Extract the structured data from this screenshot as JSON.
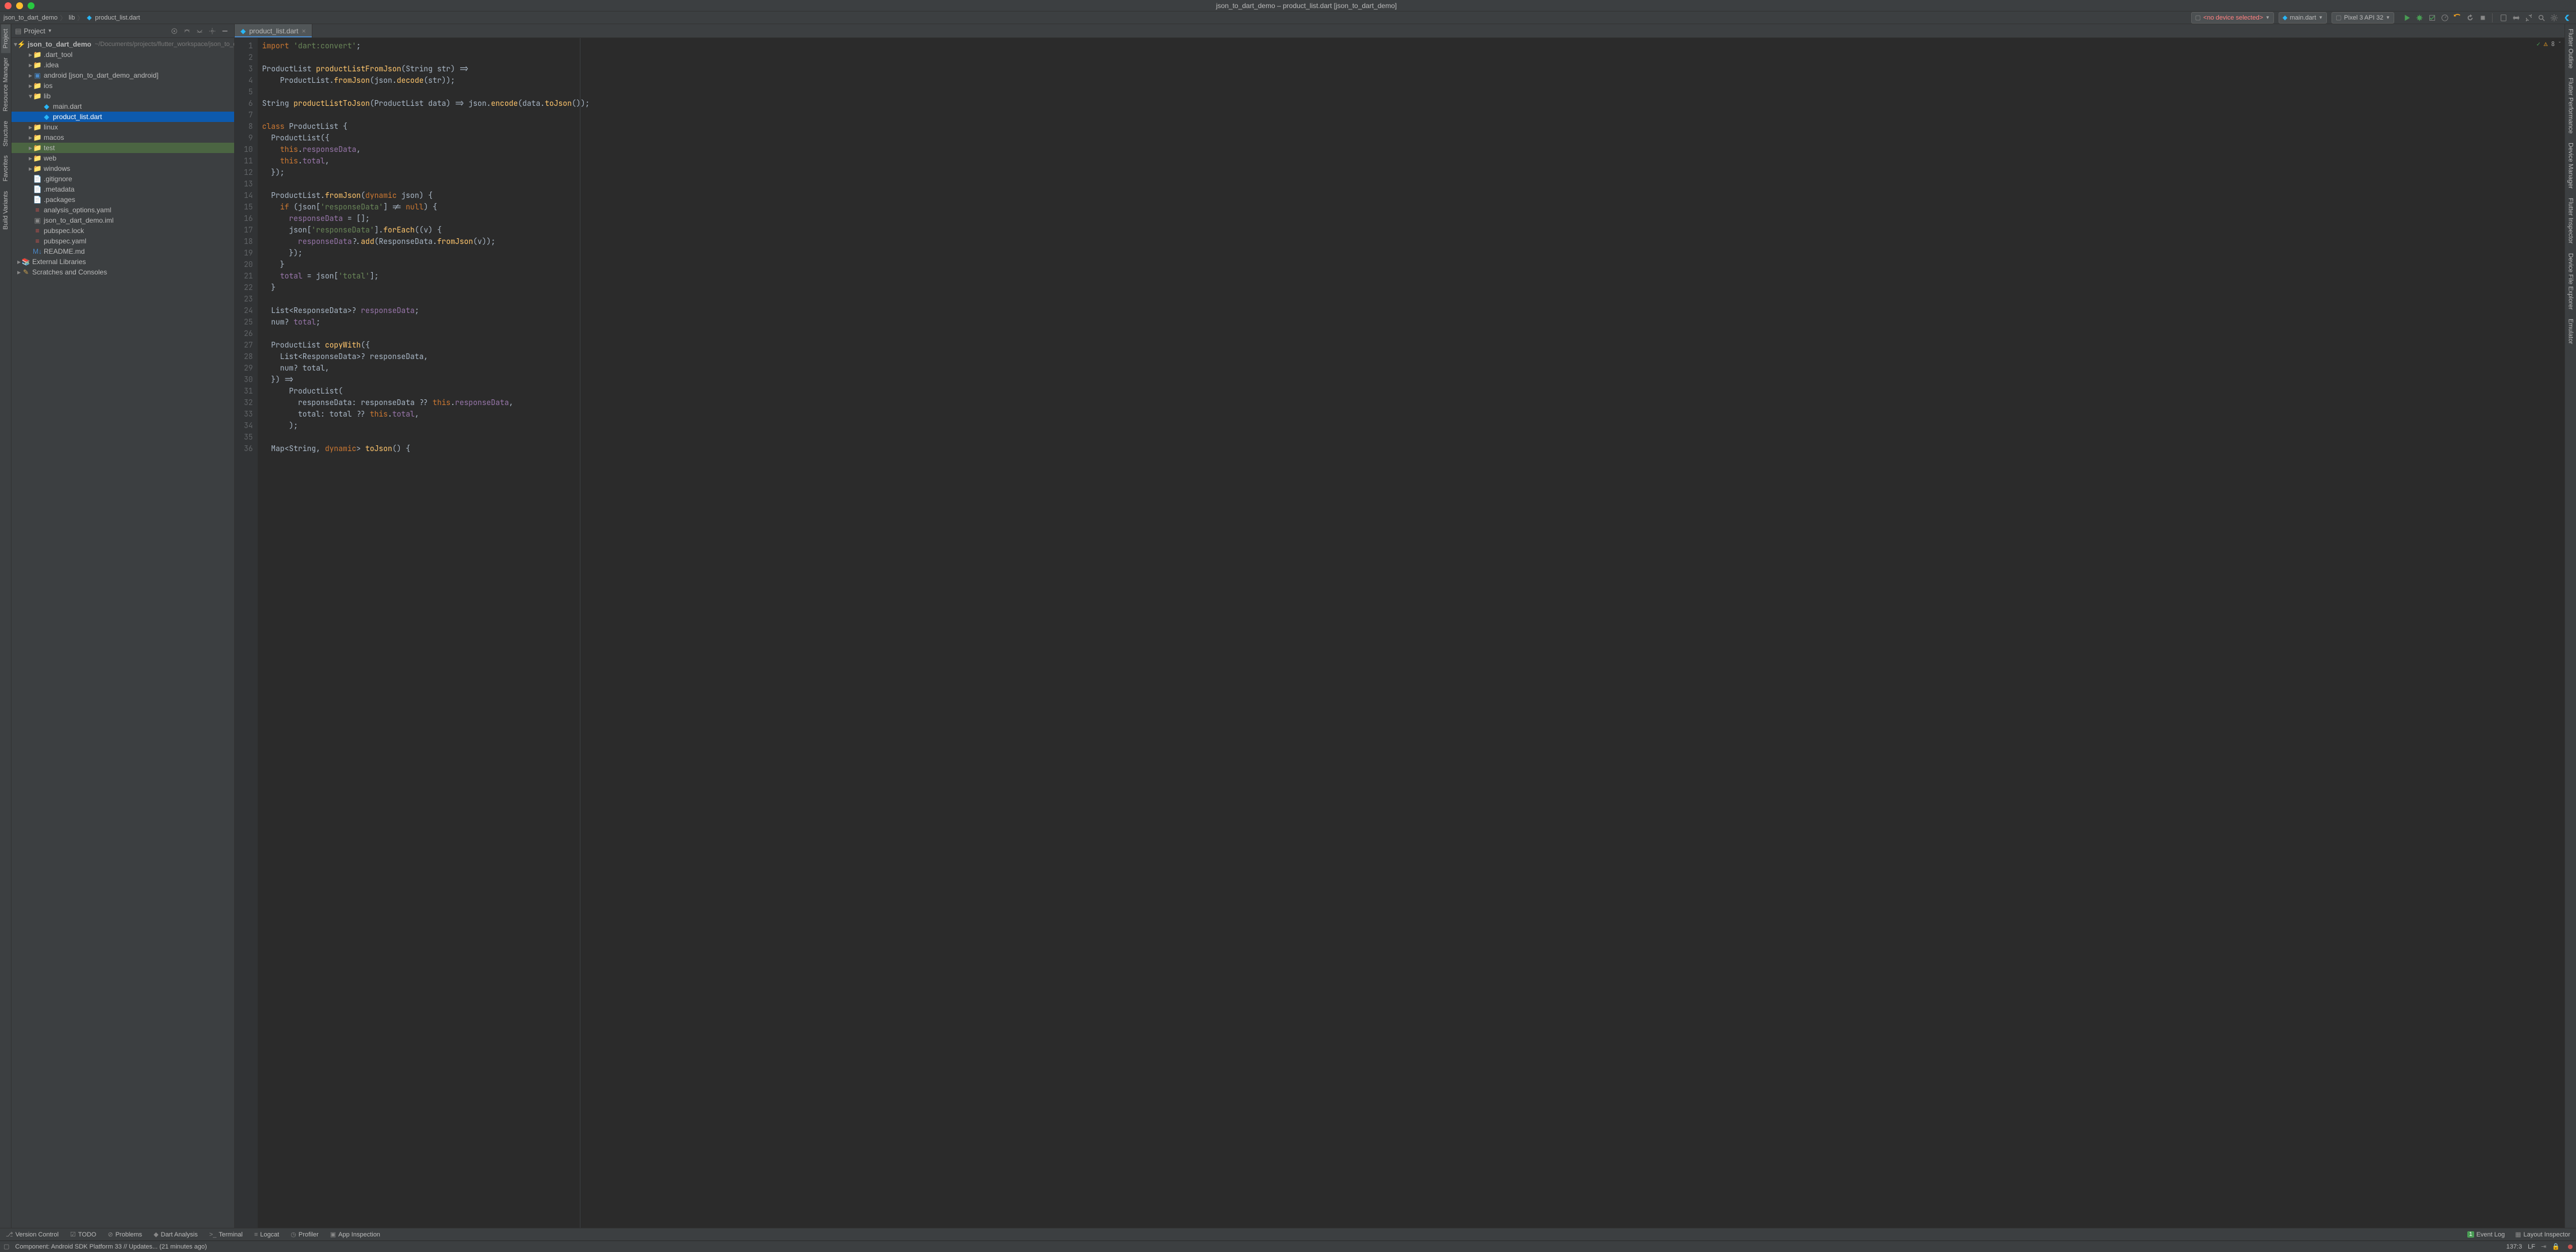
{
  "window": {
    "title": "json_to_dart_demo – product_list.dart [json_to_dart_demo]"
  },
  "breadcrumb": {
    "root": "json_to_dart_demo",
    "dir": "lib",
    "file": "product_list.dart"
  },
  "run_configs": {
    "device": "<no device selected>",
    "config": "main.dart",
    "emulator": "Pixel 3 API 32"
  },
  "project_panel": {
    "title": "Project",
    "root": {
      "name": "json_to_dart_demo",
      "path": "~/Documents/projects/flutter_workspace/json_to_dart_demo"
    },
    "tree": [
      {
        "label": ".dart_tool",
        "depth": 1,
        "expandable": true,
        "icon": "folder-orange"
      },
      {
        "label": ".idea",
        "depth": 1,
        "expandable": true,
        "icon": "folder"
      },
      {
        "label": "android [json_to_dart_demo_android]",
        "depth": 1,
        "expandable": true,
        "icon": "module"
      },
      {
        "label": "ios",
        "depth": 1,
        "expandable": true,
        "icon": "folder"
      },
      {
        "label": "lib",
        "depth": 1,
        "expandable": true,
        "expanded": true,
        "icon": "folder-blue"
      },
      {
        "label": "main.dart",
        "depth": 2,
        "icon": "dart"
      },
      {
        "label": "product_list.dart",
        "depth": 2,
        "icon": "dart",
        "selected": true
      },
      {
        "label": "linux",
        "depth": 1,
        "expandable": true,
        "icon": "folder"
      },
      {
        "label": "macos",
        "depth": 1,
        "expandable": true,
        "icon": "folder"
      },
      {
        "label": "test",
        "depth": 1,
        "expandable": true,
        "icon": "folder-green",
        "highlighted": true
      },
      {
        "label": "web",
        "depth": 1,
        "expandable": true,
        "icon": "folder"
      },
      {
        "label": "windows",
        "depth": 1,
        "expandable": true,
        "icon": "folder"
      },
      {
        "label": ".gitignore",
        "depth": 1,
        "icon": "file"
      },
      {
        "label": ".metadata",
        "depth": 1,
        "icon": "file"
      },
      {
        "label": ".packages",
        "depth": 1,
        "icon": "file"
      },
      {
        "label": "analysis_options.yaml",
        "depth": 1,
        "icon": "yaml"
      },
      {
        "label": "json_to_dart_demo.iml",
        "depth": 1,
        "icon": "iml"
      },
      {
        "label": "pubspec.lock",
        "depth": 1,
        "icon": "yaml"
      },
      {
        "label": "pubspec.yaml",
        "depth": 1,
        "icon": "yaml"
      },
      {
        "label": "README.md",
        "depth": 1,
        "icon": "md"
      }
    ],
    "roots_extra": [
      "External Libraries",
      "Scratches and Consoles"
    ]
  },
  "left_gutter_tabs": [
    "Project",
    "Resource Manager",
    "Structure",
    "Favorites",
    "Build Variants"
  ],
  "right_gutter_tabs": [
    "Flutter Outline",
    "Flutter Performance",
    "Device Manager",
    "Flutter Inspector",
    "Device File Explorer",
    "Emulator"
  ],
  "editor": {
    "tab_name": "product_list.dart",
    "inspection_count": "8",
    "lines": [
      [
        {
          "c": "k",
          "t": "import "
        },
        {
          "c": "s",
          "t": "'dart:convert'"
        },
        {
          "c": "t",
          "t": ";"
        }
      ],
      [],
      [
        {
          "c": "t",
          "t": "ProductList "
        },
        {
          "c": "c",
          "t": "productListFromJson"
        },
        {
          "c": "t",
          "t": "(String str) =>"
        }
      ],
      [
        {
          "c": "t",
          "t": "    ProductList."
        },
        {
          "c": "c",
          "t": "fromJson"
        },
        {
          "c": "t",
          "t": "(json."
        },
        {
          "c": "c",
          "t": "decode"
        },
        {
          "c": "t",
          "t": "(str));"
        }
      ],
      [],
      [
        {
          "c": "t",
          "t": "String "
        },
        {
          "c": "c",
          "t": "productListToJson"
        },
        {
          "c": "t",
          "t": "(ProductList data) => json."
        },
        {
          "c": "c",
          "t": "encode"
        },
        {
          "c": "t",
          "t": "(data."
        },
        {
          "c": "c",
          "t": "toJson"
        },
        {
          "c": "t",
          "t": "());"
        }
      ],
      [],
      [
        {
          "c": "k",
          "t": "class "
        },
        {
          "c": "t",
          "t": "ProductList {"
        }
      ],
      [
        {
          "c": "t",
          "t": "  ProductList({"
        }
      ],
      [
        {
          "c": "t",
          "t": "    "
        },
        {
          "c": "k",
          "t": "this"
        },
        {
          "c": "t",
          "t": "."
        },
        {
          "c": "p",
          "t": "responseData"
        },
        {
          "c": "t",
          "t": ","
        }
      ],
      [
        {
          "c": "t",
          "t": "    "
        },
        {
          "c": "k",
          "t": "this"
        },
        {
          "c": "t",
          "t": "."
        },
        {
          "c": "p",
          "t": "total"
        },
        {
          "c": "t",
          "t": ","
        }
      ],
      [
        {
          "c": "t",
          "t": "  });"
        }
      ],
      [],
      [
        {
          "c": "t",
          "t": "  ProductList."
        },
        {
          "c": "c",
          "t": "fromJson"
        },
        {
          "c": "t",
          "t": "("
        },
        {
          "c": "k",
          "t": "dynamic"
        },
        {
          "c": "t",
          "t": " json) {"
        }
      ],
      [
        {
          "c": "t",
          "t": "    "
        },
        {
          "c": "k",
          "t": "if "
        },
        {
          "c": "t",
          "t": "(json["
        },
        {
          "c": "s",
          "t": "'responseData'"
        },
        {
          "c": "t",
          "t": "] != "
        },
        {
          "c": "k",
          "t": "null"
        },
        {
          "c": "t",
          "t": ") {"
        }
      ],
      [
        {
          "c": "t",
          "t": "      "
        },
        {
          "c": "p",
          "t": "responseData"
        },
        {
          "c": "t",
          "t": " = [];"
        }
      ],
      [
        {
          "c": "t",
          "t": "      json["
        },
        {
          "c": "s",
          "t": "'responseData'"
        },
        {
          "c": "t",
          "t": "]."
        },
        {
          "c": "c",
          "t": "forEach"
        },
        {
          "c": "t",
          "t": "((v) {"
        }
      ],
      [
        {
          "c": "t",
          "t": "        "
        },
        {
          "c": "p",
          "t": "responseData"
        },
        {
          "c": "t",
          "t": "?."
        },
        {
          "c": "c",
          "t": "add"
        },
        {
          "c": "t",
          "t": "(ResponseData."
        },
        {
          "c": "c",
          "t": "fromJson"
        },
        {
          "c": "t",
          "t": "(v));"
        }
      ],
      [
        {
          "c": "t",
          "t": "      });"
        }
      ],
      [
        {
          "c": "t",
          "t": "    }"
        }
      ],
      [
        {
          "c": "t",
          "t": "    "
        },
        {
          "c": "p",
          "t": "total"
        },
        {
          "c": "t",
          "t": " = json["
        },
        {
          "c": "s",
          "t": "'total'"
        },
        {
          "c": "t",
          "t": "];"
        }
      ],
      [
        {
          "c": "t",
          "t": "  }"
        }
      ],
      [],
      [
        {
          "c": "t",
          "t": "  List<ResponseData>? "
        },
        {
          "c": "p",
          "t": "responseData"
        },
        {
          "c": "t",
          "t": ";"
        }
      ],
      [
        {
          "c": "t",
          "t": "  num? "
        },
        {
          "c": "p",
          "t": "total"
        },
        {
          "c": "t",
          "t": ";"
        }
      ],
      [],
      [
        {
          "c": "t",
          "t": "  ProductList "
        },
        {
          "c": "c",
          "t": "copyWith"
        },
        {
          "c": "t",
          "t": "({"
        }
      ],
      [
        {
          "c": "t",
          "t": "    List<ResponseData>? responseData,"
        }
      ],
      [
        {
          "c": "t",
          "t": "    num? total,"
        }
      ],
      [
        {
          "c": "t",
          "t": "  }) =>"
        }
      ],
      [
        {
          "c": "t",
          "t": "      ProductList("
        }
      ],
      [
        {
          "c": "t",
          "t": "        responseData: responseData ?? "
        },
        {
          "c": "k",
          "t": "this"
        },
        {
          "c": "t",
          "t": "."
        },
        {
          "c": "p",
          "t": "responseData"
        },
        {
          "c": "t",
          "t": ","
        }
      ],
      [
        {
          "c": "t",
          "t": "        total: total ?? "
        },
        {
          "c": "k",
          "t": "this"
        },
        {
          "c": "t",
          "t": "."
        },
        {
          "c": "p",
          "t": "total"
        },
        {
          "c": "t",
          "t": ","
        }
      ],
      [
        {
          "c": "t",
          "t": "      );"
        }
      ],
      [],
      [
        {
          "c": "t",
          "t": "  Map<String, "
        },
        {
          "c": "k",
          "t": "dynamic"
        },
        {
          "c": "t",
          "t": "> "
        },
        {
          "c": "c",
          "t": "toJson"
        },
        {
          "c": "t",
          "t": "() {"
        }
      ]
    ]
  },
  "bottom_tabs": [
    "Version Control",
    "TODO",
    "Problems",
    "Dart Analysis",
    "Terminal",
    "Logcat",
    "Profiler",
    "App Inspection"
  ],
  "bottom_right": {
    "event_log": "Event Log",
    "event_log_badge": "1",
    "layout_inspector": "Layout Inspector"
  },
  "status": {
    "message": "Component: Android SDK Platform 33 // Updates... (21 minutes ago)",
    "caret": "137:3",
    "encoding": "LF"
  }
}
